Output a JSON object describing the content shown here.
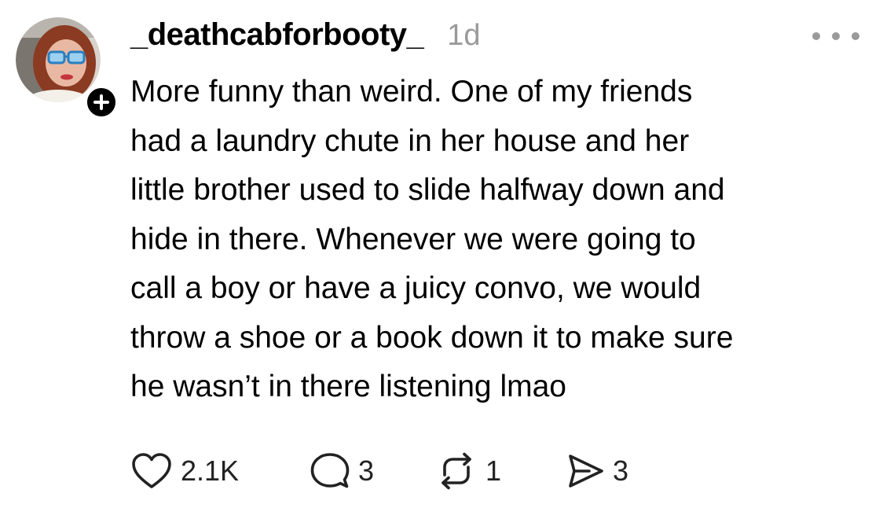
{
  "post": {
    "username": "_deathcabforbooty_",
    "timestamp": "1d",
    "body": "More funny than weird. One of my friends\nhad a laundry chute in her house and her\nlittle brother used to slide halfway down and\nhide in there. Whenever we were going to\ncall a boy or have a juicy convo, we would\nthrow a shoe or a book down it to make sure\nhe wasn’t in there listening lmao",
    "avatar_icon": "profile-photo",
    "follow_icon": "plus-icon",
    "more_icon": "more-options-icon"
  },
  "actions": {
    "like": {
      "icon": "heart-icon",
      "count": "2.1K"
    },
    "comment": {
      "icon": "speech-bubble-icon",
      "count": "3"
    },
    "repost": {
      "icon": "repost-icon",
      "count": "1"
    },
    "share": {
      "icon": "send-icon",
      "count": "3"
    }
  },
  "colors": {
    "text": "#000000",
    "muted": "#9a9a9a",
    "icon": "#222222",
    "badge": "#000000"
  }
}
